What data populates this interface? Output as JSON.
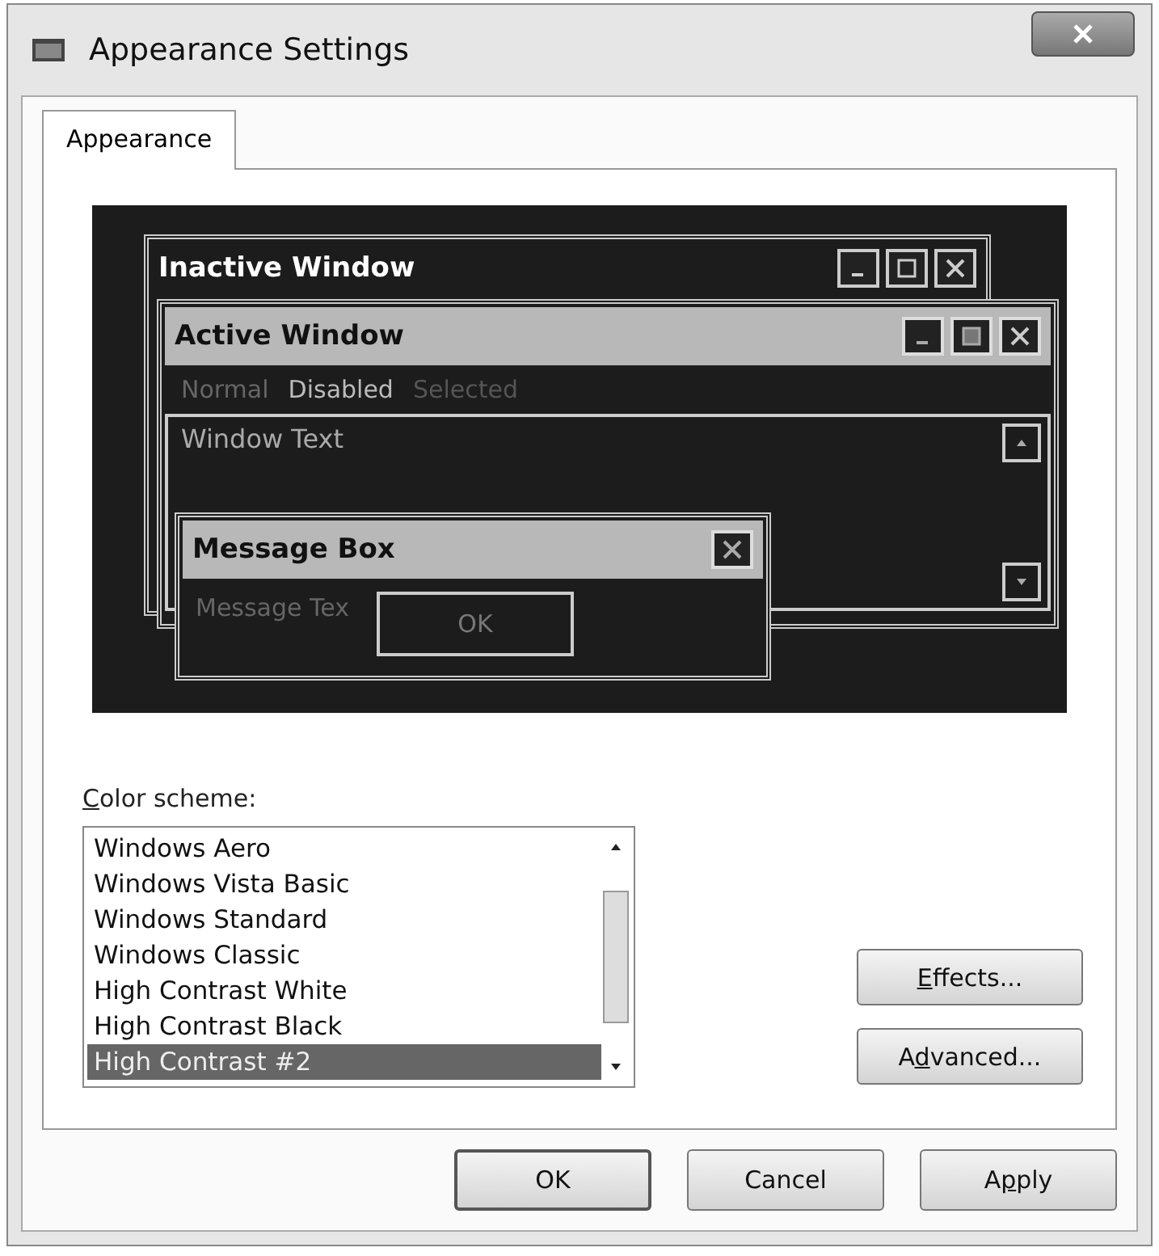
{
  "window": {
    "title": "Appearance Settings"
  },
  "tabs": [
    {
      "label": "Appearance",
      "selected": true
    }
  ],
  "preview": {
    "inactive_window": {
      "title": "Inactive Window"
    },
    "active_window": {
      "title": "Active Window",
      "menu": [
        {
          "label": "Normal",
          "kind": "normal"
        },
        {
          "label": "Disabled",
          "kind": "disabled"
        },
        {
          "label": "Selected",
          "kind": "selected"
        }
      ],
      "text": "Window Text"
    },
    "message_box": {
      "title": "Message Box",
      "text": "Message Tex",
      "button": "OK"
    }
  },
  "color_scheme": {
    "label": {
      "key": "C",
      "after": "olor scheme:"
    },
    "items": [
      {
        "label": "Windows Aero",
        "selected": false
      },
      {
        "label": "Windows Vista Basic",
        "selected": false
      },
      {
        "label": "Windows Standard",
        "selected": false
      },
      {
        "label": "Windows Classic",
        "selected": false
      },
      {
        "label": "High Contrast White",
        "selected": false
      },
      {
        "label": "High Contrast Black",
        "selected": false
      },
      {
        "label": "High Contrast #2",
        "selected": true
      }
    ]
  },
  "side_buttons": [
    {
      "label": {
        "key": "E",
        "after": "ffects..."
      }
    },
    {
      "label": {
        "before": "A",
        "key": "d",
        "after": "vanced..."
      }
    }
  ],
  "buttons": [
    {
      "label": {
        "before": "OK"
      }
    },
    {
      "label": {
        "before": "Cancel"
      }
    },
    {
      "label": {
        "before": "A",
        "key": "p",
        "after": "ply"
      }
    }
  ]
}
